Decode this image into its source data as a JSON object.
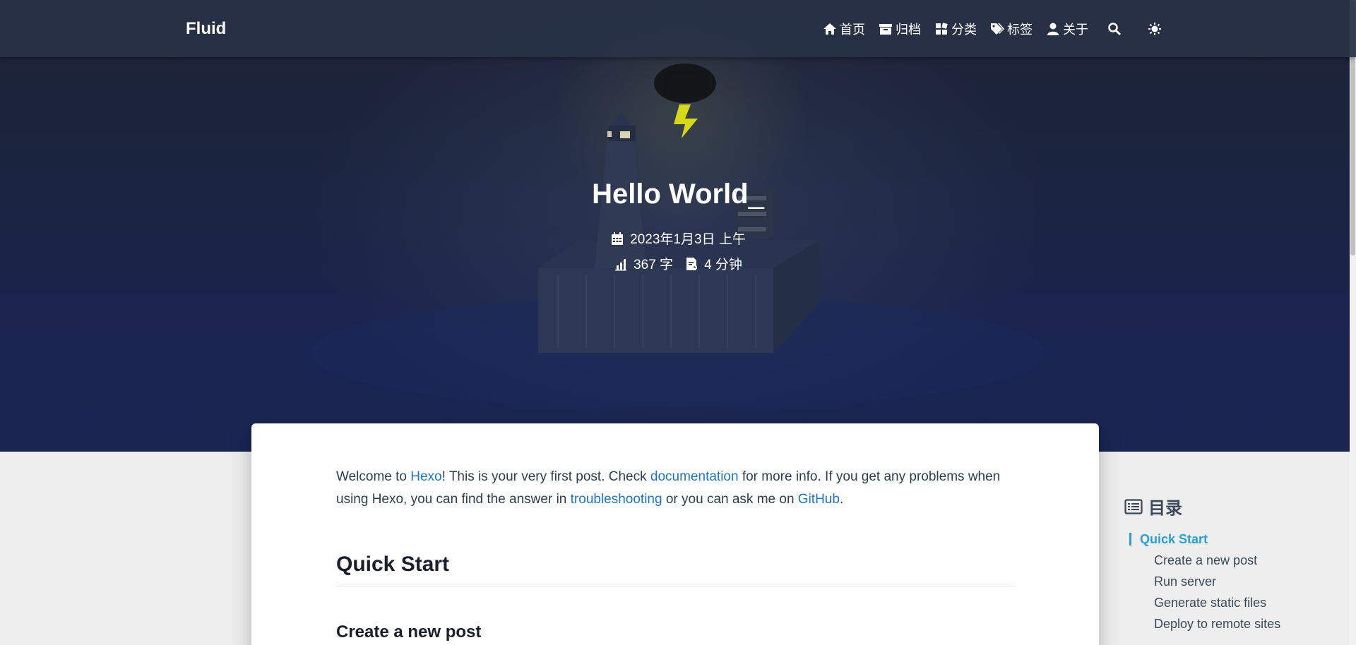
{
  "navbar": {
    "brand": "Fluid",
    "items": [
      {
        "label": "首页",
        "icon": "home-icon"
      },
      {
        "label": "归档",
        "icon": "archive-icon"
      },
      {
        "label": "分类",
        "icon": "category-icon"
      },
      {
        "label": "标签",
        "icon": "tags-icon"
      },
      {
        "label": "关于",
        "icon": "user-icon"
      }
    ],
    "search_icon": "search-icon",
    "theme_icon": "sun-icon"
  },
  "hero": {
    "title": "Hello World",
    "cursor": "_",
    "date": "2023年1月3日 上午",
    "word_count": "367 字",
    "read_time": "4 分钟"
  },
  "post": {
    "intro": {
      "t1": "Welcome to ",
      "link_hexo": "Hexo",
      "t2": "! This is your very first post. Check ",
      "link_docs": "documentation",
      "t3": " for more info. If you get any problems when using Hexo, you can find the answer in ",
      "link_trouble": "troubleshooting",
      "t4": " or you can ask me on ",
      "link_github": "GitHub",
      "t5": "."
    },
    "h2": "Quick Start",
    "h3": "Create a new post"
  },
  "toc": {
    "title": "目录",
    "items": [
      {
        "label": "Quick Start",
        "active": true
      },
      {
        "label": "Create a new post"
      },
      {
        "label": "Run server"
      },
      {
        "label": "Generate static files"
      },
      {
        "label": "Deploy to remote sites"
      }
    ]
  },
  "colors": {
    "accent": "#2a9fd6",
    "link": "#1e74c7",
    "navbar": "#283246"
  }
}
